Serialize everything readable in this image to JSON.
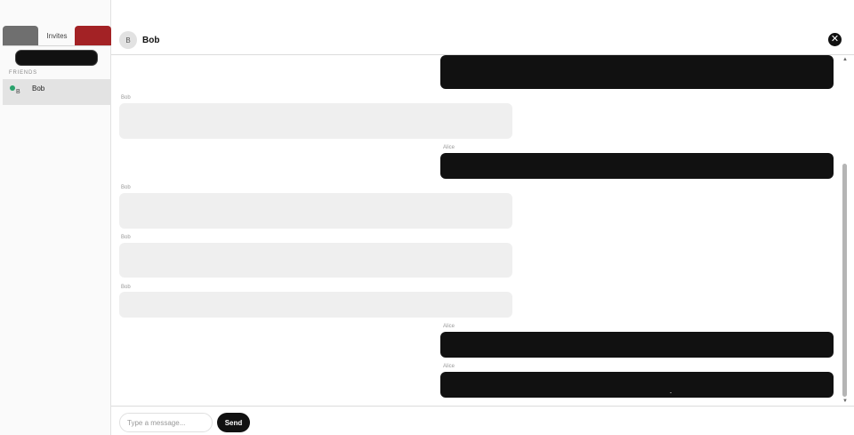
{
  "sidebar": {
    "tabs": [
      {
        "label": ""
      },
      {
        "label": "Invites"
      },
      {
        "label": ""
      }
    ],
    "section_label": "FRIENDS",
    "friends": [
      {
        "initial": "B",
        "name": "Bob",
        "status_color": "#2aa26c"
      }
    ]
  },
  "chat": {
    "avatar_initial": "B",
    "title": "Bob",
    "close_icon": "✕",
    "messages": [
      {
        "sender": "",
        "side": "alice"
      },
      {
        "sender": "Bob",
        "side": "bob"
      },
      {
        "sender": "Alice",
        "side": "alice"
      },
      {
        "sender": "Bob",
        "side": "bob"
      },
      {
        "sender": "Bob",
        "side": "bob"
      },
      {
        "sender": "Bob",
        "side": "bob"
      },
      {
        "sender": "Alice",
        "side": "alice"
      },
      {
        "sender": "Alice",
        "side": "alice"
      }
    ]
  },
  "composer": {
    "placeholder": "Type a message...",
    "value": "",
    "send_label": "Send"
  },
  "colors": {
    "accent": "#111111",
    "bob_bubble": "#efefef",
    "alice_bubble": "#111111",
    "online": "#2aa26c",
    "red_tab": "#a32225"
  }
}
